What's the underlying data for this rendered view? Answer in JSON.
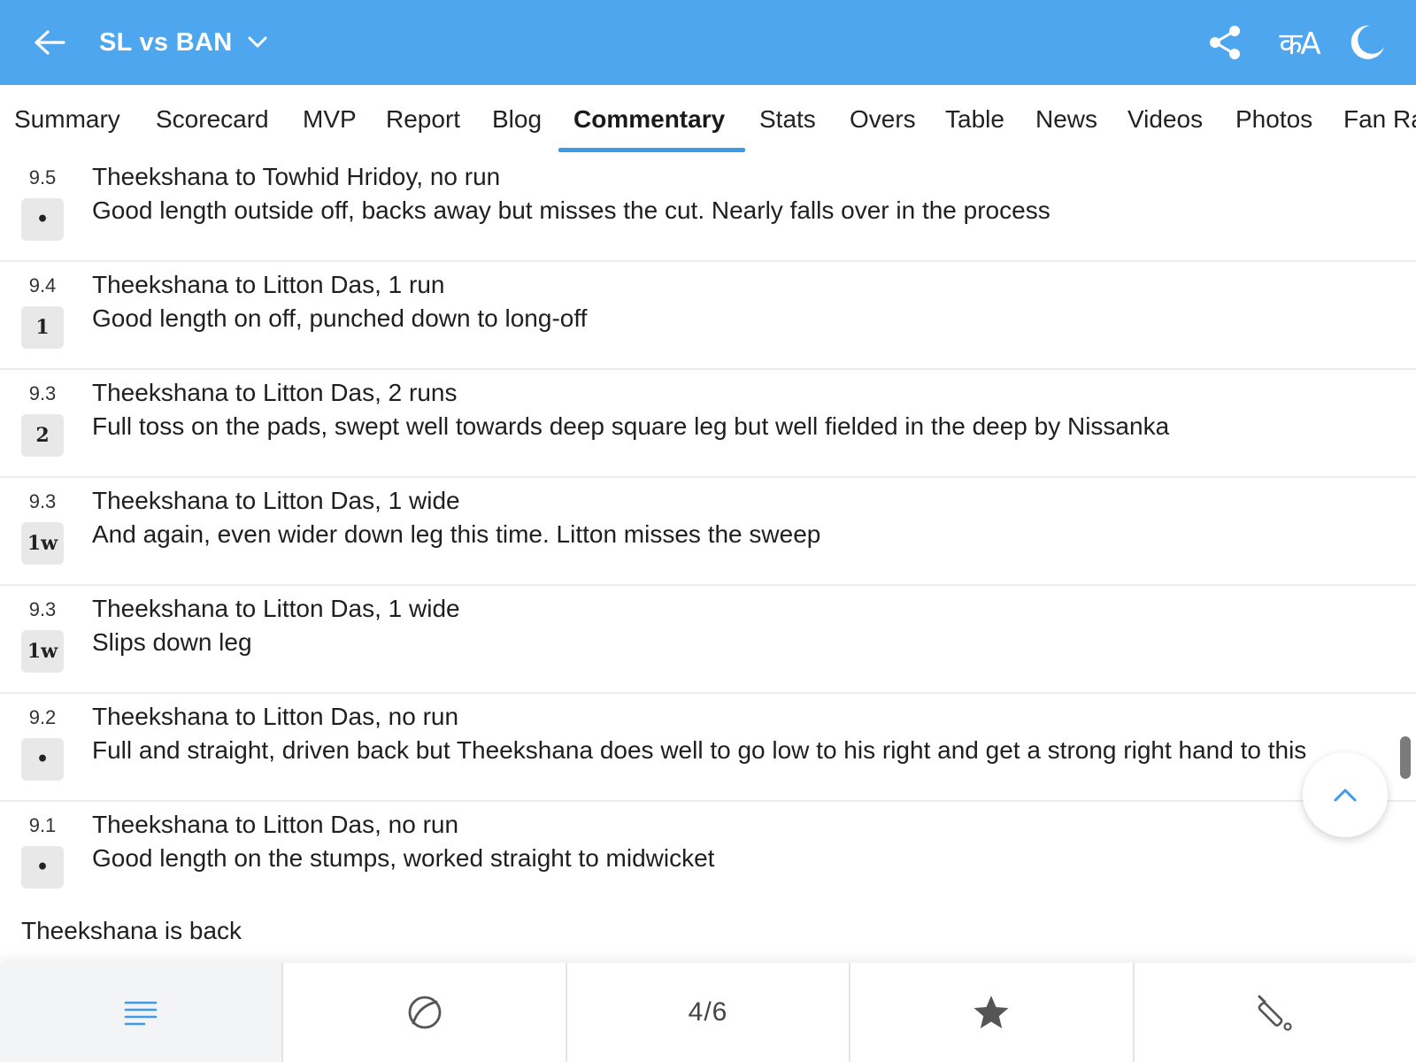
{
  "header": {
    "title": "SL vs BAN",
    "lang_label": "कA"
  },
  "tabs": [
    {
      "label": "Summary",
      "active": false
    },
    {
      "label": "Scorecard",
      "active": false
    },
    {
      "label": "MVP",
      "active": false
    },
    {
      "label": "Report",
      "active": false
    },
    {
      "label": "Blog",
      "active": false
    },
    {
      "label": "Commentary",
      "active": true
    },
    {
      "label": "Stats",
      "active": false
    },
    {
      "label": "Overs",
      "active": false
    },
    {
      "label": "Table",
      "active": false
    },
    {
      "label": "News",
      "active": false
    },
    {
      "label": "Videos",
      "active": false
    },
    {
      "label": "Photos",
      "active": false
    },
    {
      "label": "Fan Ra",
      "active": false
    }
  ],
  "commentary": [
    {
      "over": "9.5",
      "badge": "•",
      "title": "Theekshana to Towhid Hridoy, no run",
      "text": "Good length outside off, backs away but misses the cut. Nearly falls over in the process"
    },
    {
      "over": "9.4",
      "badge": "1",
      "title": "Theekshana to Litton Das, 1 run",
      "text": "Good length on off, punched down to long-off"
    },
    {
      "over": "9.3",
      "badge": "2",
      "title": "Theekshana to Litton Das, 2 runs",
      "text": "Full toss on the pads, swept well towards deep square leg but well fielded in the deep by Nissanka"
    },
    {
      "over": "9.3",
      "badge": "1w",
      "title": "Theekshana to Litton Das, 1 wide",
      "text": "And again, even wider down leg this time. Litton misses the sweep"
    },
    {
      "over": "9.3",
      "badge": "1w",
      "title": "Theekshana to Litton Das, 1 wide",
      "text": "Slips down leg"
    },
    {
      "over": "9.2",
      "badge": "•",
      "title": "Theekshana to Litton Das, no run",
      "text": "Full and straight, driven back but Theekshana does well to go low to his right and get a strong right hand to this"
    },
    {
      "over": "9.1",
      "badge": "•",
      "title": "Theekshana to Litton Das, no run",
      "text": "Good length on the stumps, worked straight to midwicket"
    }
  ],
  "note": "Theekshana is back",
  "bottom_bar": {
    "pager": "4/6",
    "icons": [
      "list-icon",
      "ball-icon",
      "star-icon",
      "bat-icon"
    ]
  },
  "colors": {
    "header_bg": "#4da6ee",
    "accent": "#3d9ae8"
  }
}
